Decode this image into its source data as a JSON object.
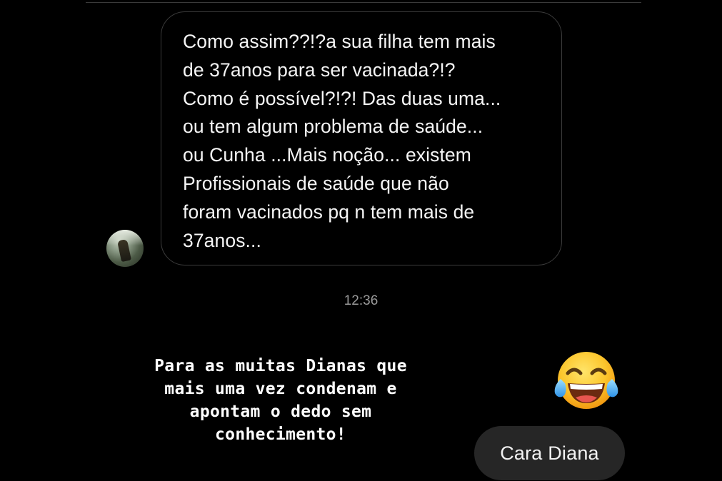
{
  "thread": {
    "received_message": "Como assim??!?a sua filha tem mais\nde 37anos para ser vacinada?!?\nComo é possível?!?! Das duas uma...\nou tem algum problema de saúde...\nou Cunha ...Mais noção... existem\nProfissionais de saúde que não\nforam vacinados pq n tem mais de\n37anos...",
    "timestamp": "12:36",
    "sent_reply": "Cara Diana"
  },
  "story_overlay": {
    "caption": "Para as muitas Dianas que\nmais uma vez condenam e\napontam o dedo sem\nconhecimento!",
    "emoji": "face-with-tears-of-joy"
  },
  "colors": {
    "background": "#000000",
    "bubble_border": "#3b3b3b",
    "reply_bubble": "#262626",
    "timestamp": "#9a9a9a"
  }
}
